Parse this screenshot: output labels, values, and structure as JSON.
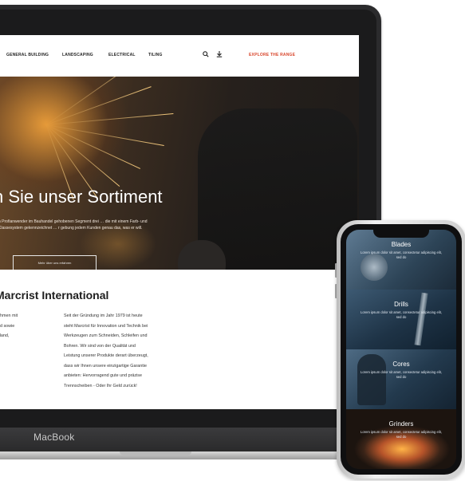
{
  "device": {
    "laptop_label": "MacBook"
  },
  "nav": {
    "items": [
      "GENERAL BUILDING",
      "LANDSCAPING",
      "ELECTRICAL",
      "TILING"
    ],
    "search_icon": "search-icon",
    "download_icon": "download-icon",
    "cta": "EXPLORE THE RANGE",
    "accent": "#d8452b"
  },
  "hero": {
    "title": "n Sie unser Sortiment",
    "text": "n Profianwender im Bauhandel gehobenen Segment drei … die mit einem Farb- und Klassesystem gekennzeichnet … r gebung jedem Kunden genau das, was er will.",
    "button": "Mehr über uns erfahren"
  },
  "content": {
    "title": "Marcrist International",
    "left_lines": [
      "nehmen mit",
      "and sowie",
      "chland,",
      "n,",
      "."
    ],
    "right_lines": [
      "Seit der Gründung im Jahr 1979 ist heute",
      "steht Marcrist für Innovation und Technik bei",
      "Werkzeugen zum Schneiden, Schleifen und",
      "Bohren. Wir sind von der Qualität und",
      "Leistung unserer Produkte derart überzeugt,",
      "dass wir Ihnen unsere einzigartige Garantie",
      "anbieten: Hervorragend gute und präzise",
      "Trennscheiben - Oder Ihr Geld zurück!"
    ]
  },
  "phone": {
    "panels": [
      {
        "title": "Blades",
        "text": "Lorem ipsum dolor sit amet, consectetur adipiscing elit, sed do"
      },
      {
        "title": "Drills",
        "text": "Lorem ipsum dolor sit amet, consectetur adipiscing elit, sed do"
      },
      {
        "title": "Cores",
        "text": "Lorem ipsum dolor sit amet, consectetur adipiscing elit, sed do"
      },
      {
        "title": "Grinders",
        "text": "Lorem ipsum dolor sit amet, consectetur adipiscing elit, sed do"
      }
    ]
  }
}
